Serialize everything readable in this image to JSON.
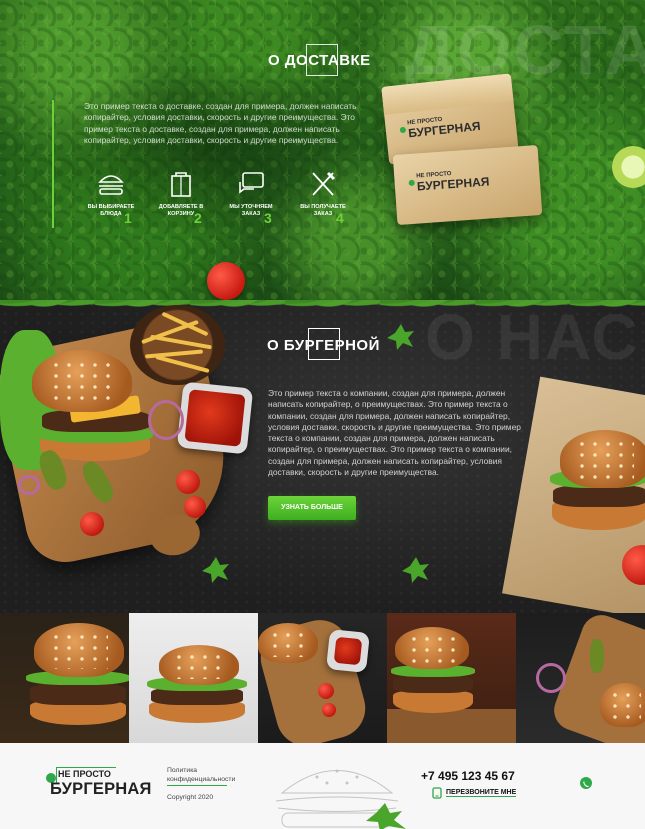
{
  "delivery": {
    "background_word": "ДОСТА",
    "title": "О ДОСТАВКЕ",
    "text": "Это пример текста о доставке, создан для примера, должен написать копирайтер, условия доставки, скорость и другие преимущества. Это пример текста о доставке, создан для примера, должен написать копирайтер, условия доставки, скорость и другие преимущества.",
    "steps": [
      {
        "icon": "burger-icon",
        "label": "ВЫ ВЫБИРАЕТЕ БЛЮДА",
        "number": "1"
      },
      {
        "icon": "bag-icon",
        "label": "ДОБАВЛЯЕТЕ В КОРЗИНУ",
        "number": "2"
      },
      {
        "icon": "chat-icon",
        "label": "МЫ УТОЧНЯЕМ ЗАКАЗ",
        "number": "3"
      },
      {
        "icon": "cutlery-icon",
        "label": "ВЫ ПОЛУЧАЕТЕ ЗАКАЗ",
        "number": "4"
      }
    ],
    "box_brand_small": "НЕ ПРОСТО",
    "box_brand_big": "БУРГЕРНАЯ"
  },
  "about": {
    "background_word": "О НАС",
    "title": "О БУРГЕРНОЙ",
    "text": "Это пример текста о компании, создан для примера, должен написать копирайтер, о преимуществах. Это пример текста о компании, создан для примера, должен написать копирайтер, условия доставки, скорость и другие преимущества. Это пример текста о компании, создан для примера, должен написать копирайтер, о преимуществах. Это пример текста о компании, создан для примера, должен написать копирайтер, условия доставки, скорость и другие преимущества.",
    "button_label": "УЗНАТЬ БОЛЬШЕ"
  },
  "footer": {
    "logo_small": "НЕ ПРОСТО",
    "logo_big": "БУРГЕРНАЯ",
    "policy": "Политика конфиденциальности",
    "copyright": "Copyright 2020",
    "phone": "+7 495 123 45 67",
    "callback": "ПЕРЕЗВОНИТЕ МНЕ",
    "callback_icon": "phone-icon",
    "social_icon": "whatsapp-icon"
  },
  "colors": {
    "accent": "#6fd13a",
    "brand_green": "#2fa84a",
    "dark_bg": "#222222",
    "footer_bg": "#f7f7f7"
  }
}
